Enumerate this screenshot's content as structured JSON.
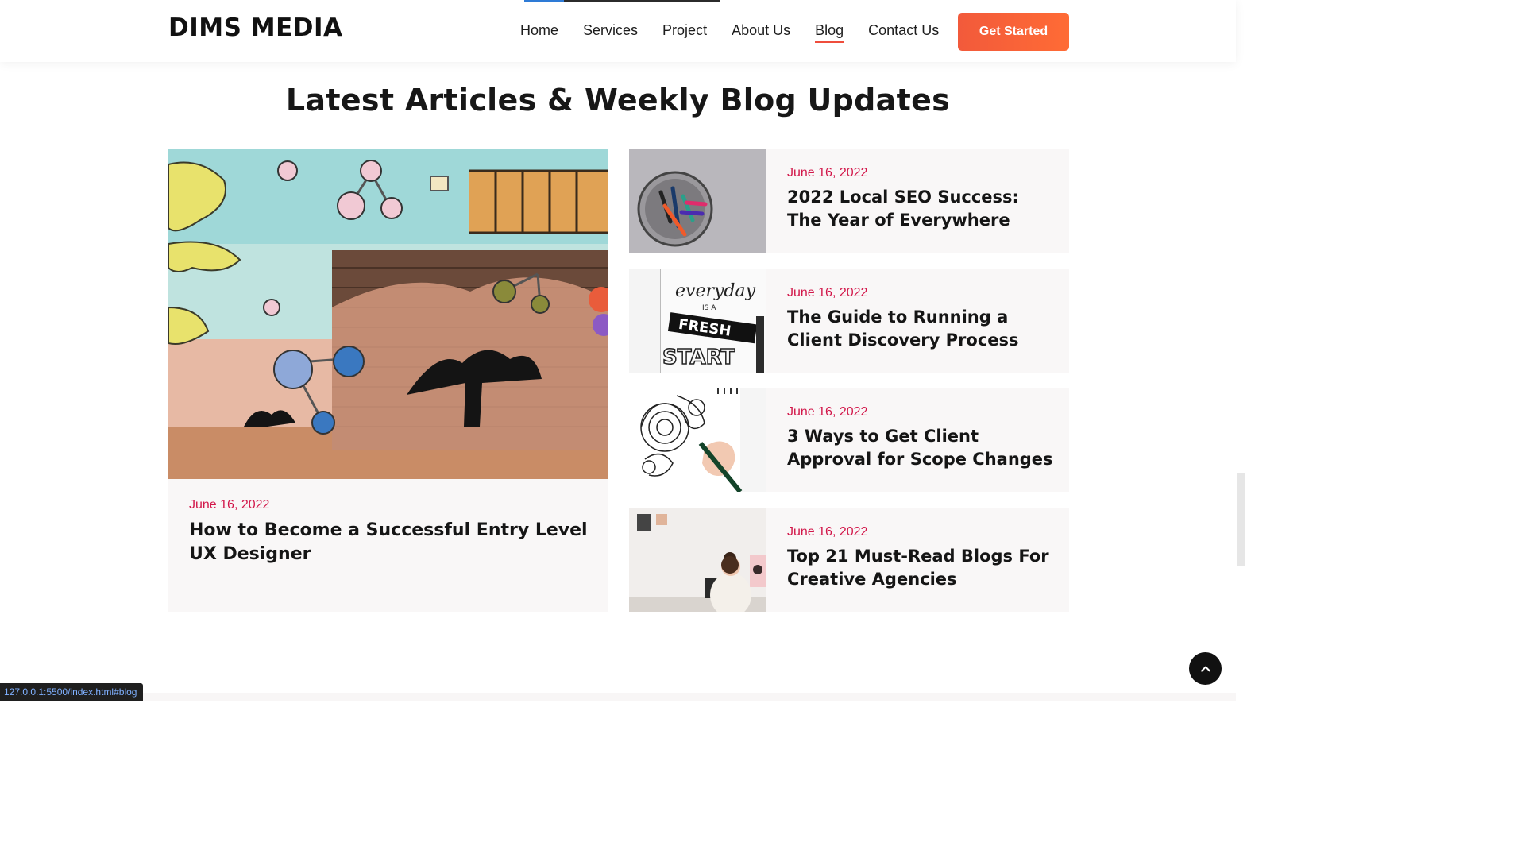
{
  "header": {
    "logo": "DIMS MEDIA",
    "nav": [
      "Home",
      "Services",
      "Project",
      "About Us",
      "Blog",
      "Contact Us"
    ],
    "active_nav": "Blog",
    "cta": "Get Started"
  },
  "section": {
    "title": "Latest Articles & Weekly Blog Updates"
  },
  "featured": {
    "date": "June 16, 2022",
    "title": "How to Become a Successful Entry Level UX Designer",
    "image": "graffiti-mural-image"
  },
  "posts": [
    {
      "date": "June 16, 2022",
      "title": "2022 Local SEO Success: The Year of Everywhere",
      "image": "pens-cup-image"
    },
    {
      "date": "June 16, 2022",
      "title": "The Guide to Running a Client Discovery Process",
      "image": "everyday-fresh-start-notebook-image"
    },
    {
      "date": "June 16, 2022",
      "title": "3 Ways to Get Client Approval for Scope Changes",
      "image": "hand-drawing-doodle-image"
    },
    {
      "date": "June 16, 2022",
      "title": "Top 21 Must-Read Blogs For Creative Agencies",
      "image": "woman-at-desk-image"
    }
  ],
  "status_bar": {
    "url": "127.0.0.1:5500/index.html#blog"
  },
  "colors": {
    "accent": "#f25a3b",
    "date": "#d2174a",
    "card_bg": "#f9f7f7"
  },
  "icons": {
    "back_to_top": "chevron-up-icon"
  }
}
